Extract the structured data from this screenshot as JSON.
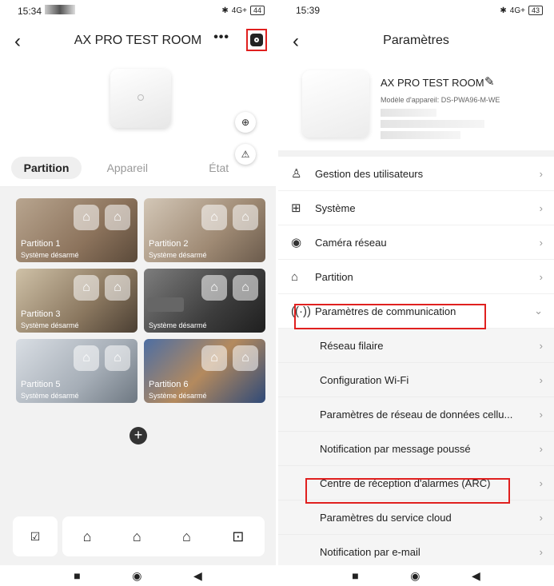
{
  "left": {
    "status": {
      "time": "15:34",
      "signal": "4G+",
      "battery": "44"
    },
    "header": {
      "title": "AX PRO TEST ROOM",
      "more": "•••"
    },
    "tabs": [
      "Partition",
      "Appareil",
      "État"
    ],
    "partitions": [
      {
        "name": "Partition 1",
        "status": "Système désarmé"
      },
      {
        "name": "Partition 2",
        "status": "Système désarmé"
      },
      {
        "name": "Partition 3",
        "status": "Système désarmé"
      },
      {
        "name": "",
        "status": "Système désarmé"
      },
      {
        "name": "Partition 5",
        "status": "Système désarmé"
      },
      {
        "name": "Partition 6",
        "status": "Système désarmé"
      }
    ]
  },
  "right": {
    "status": {
      "time": "15:39",
      "signal": "4G+",
      "battery": "43"
    },
    "header": {
      "title": "Paramètres"
    },
    "device": {
      "name": "AX PRO TEST ROOM",
      "model": "Modèle d'appareil: DS-PWA96-M-WE"
    },
    "menu": [
      {
        "label": "Gestion des utilisateurs",
        "icon": "user-icon"
      },
      {
        "label": "Système",
        "icon": "system-icon"
      },
      {
        "label": "Caméra réseau",
        "icon": "camera-icon"
      },
      {
        "label": "Partition",
        "icon": "partition-icon"
      },
      {
        "label": "Paramètres de communication",
        "icon": "antenna-icon"
      }
    ],
    "submenu": [
      {
        "label": "Réseau filaire"
      },
      {
        "label": "Configuration Wi-Fi"
      },
      {
        "label": "Paramètres de réseau de données cellu..."
      },
      {
        "label": "Notification par message poussé"
      },
      {
        "label": "Centre de réception d'alarmes (ARC)"
      },
      {
        "label": "Paramètres du service cloud"
      },
      {
        "label": "Notification par e-mail"
      }
    ]
  }
}
